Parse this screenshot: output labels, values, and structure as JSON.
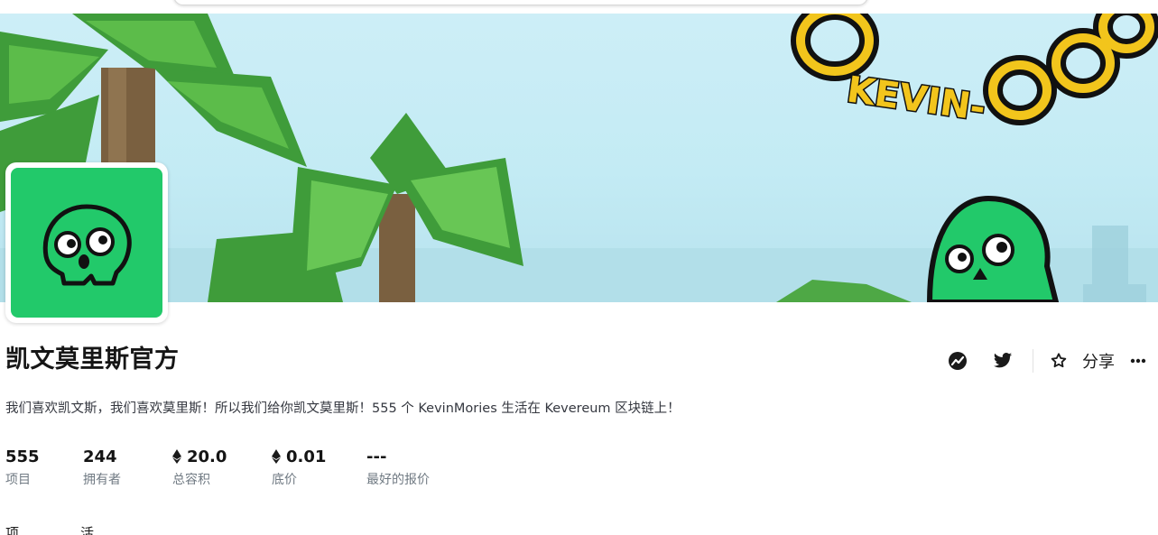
{
  "collection": {
    "title": "凯文莫里斯官方",
    "description": "我们喜欢凯文斯，我们喜欢莫里斯！所以我们给你凯文莫里斯！555 个 KevinMories 生活在 Kevereum 区块链上！",
    "banner_text": "KEVIN-"
  },
  "stats": [
    {
      "value": "555",
      "label": "项目",
      "eth": false
    },
    {
      "value": "244",
      "label": "拥有者",
      "eth": false
    },
    {
      "value": "20.0",
      "label": "总容积",
      "eth": true
    },
    {
      "value": "0.01",
      "label": "底价",
      "eth": true
    },
    {
      "value": "---",
      "label": "最好的报价",
      "eth": false
    }
  ],
  "actions": {
    "share_label": "分享",
    "icons": [
      "activity-chart-icon",
      "twitter-icon",
      "star-icon",
      "more-icon"
    ]
  },
  "tabs": [
    {
      "label": "项"
    },
    {
      "label": "活"
    }
  ],
  "colors": {
    "brand_green": "#22c96a",
    "chain_yellow": "#f2c51c",
    "sky": "#c3ebf4"
  }
}
